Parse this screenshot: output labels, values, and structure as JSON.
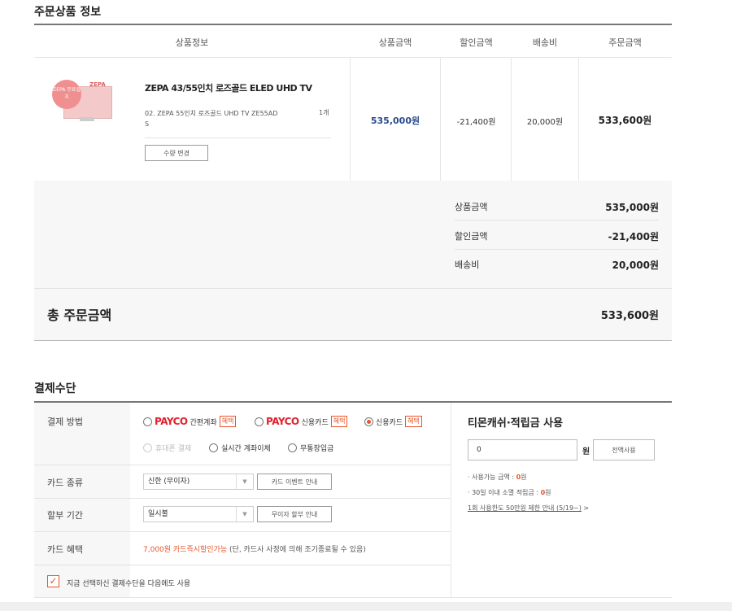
{
  "order_section": {
    "title": "주문상품 정보",
    "headers": [
      "상품정보",
      "상품금액",
      "할인금액",
      "배송비",
      "주문금액"
    ],
    "product": {
      "thumb_badge": "ZEPA 무료설치",
      "thumb_brand": "ZEPA",
      "name": "ZEPA 43/55인치 로즈골드 ELED UHD TV",
      "option_line1": "02. ZEPA 55인치 로즈골드 UHD TV ZE55AD",
      "option_line2": "S",
      "quantity": "1개",
      "qty_change_label": "수량 변경",
      "price": "535,000원",
      "discount": "-21,400원",
      "shipping": "20,000원",
      "order_total": "533,600원"
    }
  },
  "summary": {
    "product_label": "상품금액",
    "product_value": "535,000원",
    "discount_label": "할인금액",
    "discount_value": "-21,400원",
    "shipping_label": "배송비",
    "shipping_value": "20,000원",
    "total_label": "총 주문금액",
    "total_value": "533,600원"
  },
  "payment": {
    "title": "결제수단",
    "method_label": "결제 방법",
    "methods": [
      {
        "brand": "PAYCO",
        "label": "간편계좌",
        "tag": "혜택",
        "selected": false
      },
      {
        "brand": "PAYCO",
        "label": "신용카드",
        "tag": "혜택",
        "selected": false
      },
      {
        "brand": "",
        "label": "신용카드",
        "tag": "혜택",
        "selected": true
      }
    ],
    "methods_row2": [
      {
        "label": "휴대폰 결제",
        "disabled": true
      },
      {
        "label": "실시간 계좌이체",
        "disabled": false
      },
      {
        "label": "무통장입금",
        "disabled": false
      }
    ],
    "card_type_label": "카드 종류",
    "card_type_value": "신한 (무이자)",
    "card_event_btn": "카드 이벤트 안내",
    "installment_label": "할부 기간",
    "installment_value": "일시불",
    "interest_free_btn": "무이자 할부 안내",
    "benefit_label": "카드 혜택",
    "benefit_highlight": "7,000원 카드즉시할인가능",
    "benefit_note": "(단, 카드사 사정에 의해 조기종료될 수 있음)",
    "remember_label": "지금 선택하신 결제수단을 다음에도 사용"
  },
  "cash": {
    "title": "티몬캐쉬·적립금 사용",
    "input_value": "0",
    "unit": "원",
    "use_all_btn": "전액사용",
    "available_prefix": "· 사용가능 금액 : ",
    "available_value": "0",
    "available_suffix": "원",
    "expiring_prefix": "· 30일 이내 소멸 적립금 : ",
    "expiring_value": "0",
    "expiring_suffix": "원",
    "limit_link": "1회 사용한도 50만원 제한 안내 (5/19~)",
    "limit_arrow": ">"
  }
}
